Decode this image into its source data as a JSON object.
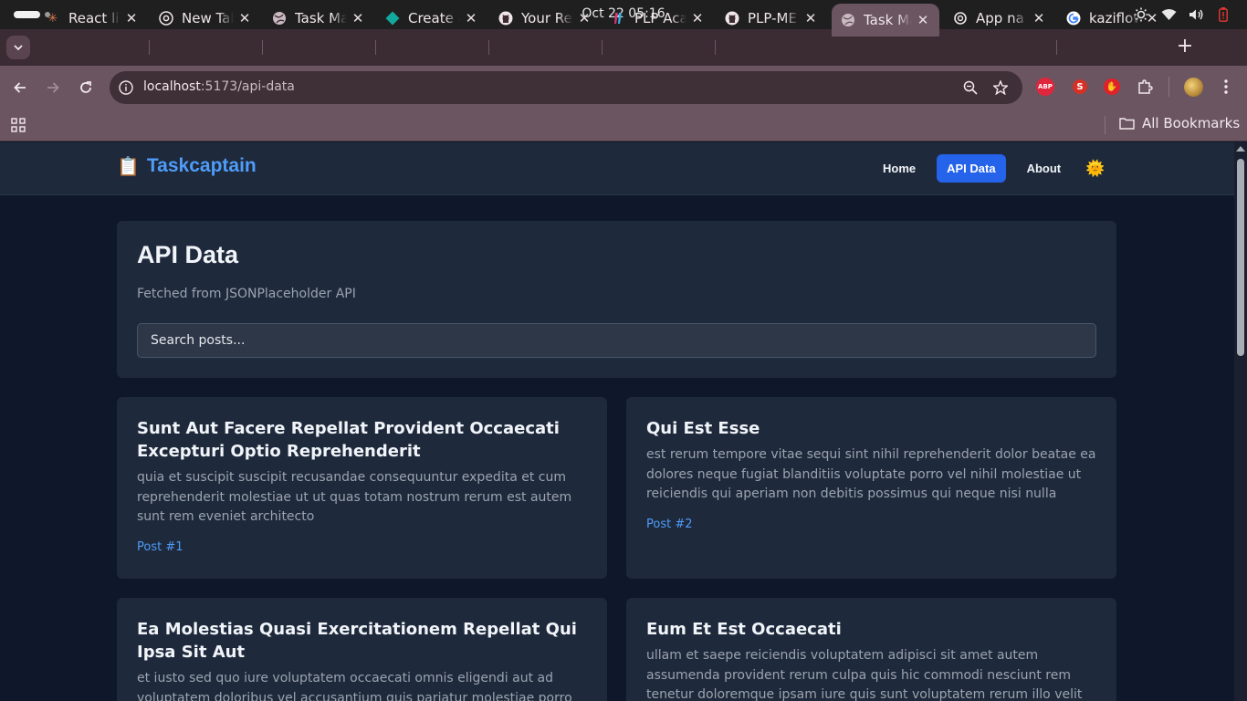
{
  "os": {
    "clock": "Oct 22  05:16"
  },
  "tabs": [
    {
      "title": "React li",
      "icon": "asterisk-icon"
    },
    {
      "title": "New Tab",
      "icon": "chrome-icon"
    },
    {
      "title": "Task Ma",
      "icon": "globe-icon"
    },
    {
      "title": "Create a",
      "icon": "diamond-icon"
    },
    {
      "title": "Your Re",
      "icon": "github-icon"
    },
    {
      "title": "PLP Aca",
      "icon": "plp-icon"
    },
    {
      "title": "PLP-ME",
      "icon": "github-icon"
    },
    {
      "title": "Task Ma",
      "icon": "globe-icon"
    },
    {
      "title": "App na",
      "icon": "openai-icon"
    },
    {
      "title": "kaziflow",
      "icon": "google-icon"
    }
  ],
  "omnibox": {
    "host": "localhost",
    "path": ":5173/api-data"
  },
  "bookmarks": {
    "all_label": "All Bookmarks"
  },
  "extensions": {
    "abp_label": "ABP",
    "s_label": "S"
  },
  "app": {
    "brand": "Taskcaptain",
    "brand_emoji": "📋",
    "nav": {
      "home": "Home",
      "api": "API Data",
      "about": "About",
      "theme": "🌞"
    },
    "title": "API Data",
    "subtitle": "Fetched from JSONPlaceholder API",
    "search_placeholder": "Search posts..."
  },
  "posts": [
    {
      "title": "Sunt Aut Facere Repellat Provident Occaecati Excepturi Optio Reprehenderit",
      "body": "quia et suscipit suscipit recusandae consequuntur expedita et cum reprehenderit molestiae ut ut quas totam nostrum rerum est autem sunt rem eveniet architecto",
      "tag": "Post #1"
    },
    {
      "title": "Qui Est Esse",
      "body": "est rerum tempore vitae sequi sint nihil reprehenderit dolor beatae ea dolores neque fugiat blanditiis voluptate porro vel nihil molestiae ut reiciendis qui aperiam non debitis possimus qui neque nisi nulla",
      "tag": "Post #2"
    },
    {
      "title": "Ea Molestias Quasi Exercitationem Repellat Qui Ipsa Sit Aut",
      "body": "et iusto sed quo iure voluptatem occaecati omnis eligendi aut ad voluptatem doloribus vel accusantium quis pariatur molestiae porro eius",
      "tag": ""
    },
    {
      "title": "Eum Et Est Occaecati",
      "body": "ullam et saepe reiciendis voluptatem adipisci sit amet autem assumenda provident rerum culpa quis hic commodi nesciunt rem tenetur doloremque ipsam iure quis sunt voluptatem rerum illo velit",
      "tag": ""
    }
  ],
  "colors": {
    "accent": "#2563eb",
    "brand": "#4f9cf9",
    "card": "#1e293b",
    "page_bg": "#0f172a"
  }
}
